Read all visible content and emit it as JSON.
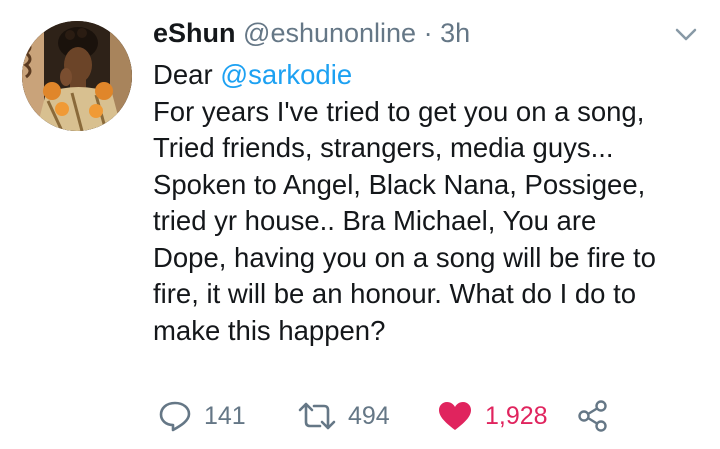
{
  "tweet": {
    "display_name": "eShun",
    "handle": "@eshunonline",
    "separator": "·",
    "time": "3h",
    "greeting": "Dear",
    "mention": "@sarkodie",
    "lines": [
      "For years I've tried to get you on a song,",
      "Tried friends, strangers, media guys...",
      "Spoken to Angel, Black Nana, Possigee,",
      "tried yr house.. Bra Michael, You are",
      "Dope, having you on a song will be fire to",
      "fire, it will be an honour. What do I do to",
      "make this happen?"
    ]
  },
  "actions": {
    "reply_count": "141",
    "retweet_count": "494",
    "like_count": "1,928",
    "liked": true
  },
  "colors": {
    "text": "#14171a",
    "secondary": "#657786",
    "link": "#1da1f2",
    "like": "#e0245e"
  },
  "icons": {
    "menu": "chevron-down-icon",
    "reply": "reply-icon",
    "retweet": "retweet-icon",
    "like": "heart-icon",
    "share": "share-icon"
  }
}
